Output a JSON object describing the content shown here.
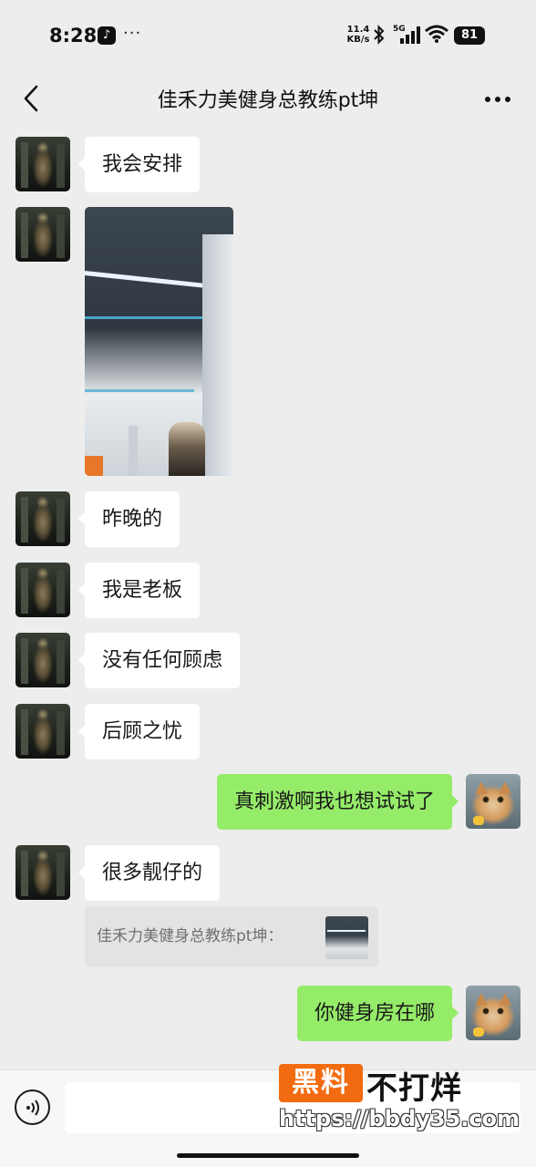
{
  "status_bar": {
    "time": "8:28",
    "app_icon": "tiktok-icon",
    "more": "···",
    "net_speed_value": "11.4",
    "net_speed_unit": "KB/s",
    "network": "5G",
    "battery": "81"
  },
  "header": {
    "title": "佳禾力美健身总教练pt坤",
    "back_icon": "chevron-left-icon",
    "menu_icon": "more-horizontal-icon"
  },
  "messages": [
    {
      "type": "text",
      "side": "in",
      "text": "我会安排"
    },
    {
      "type": "image",
      "side": "in",
      "description_icon": "gym-photo"
    },
    {
      "type": "text",
      "side": "in",
      "text": "昨晚的"
    },
    {
      "type": "text",
      "side": "in",
      "text": "我是老板"
    },
    {
      "type": "text",
      "side": "in",
      "text": "没有任何顾虑"
    },
    {
      "type": "text",
      "side": "in",
      "text": "后顾之忧"
    },
    {
      "type": "text",
      "side": "out",
      "text": "真刺激啊我也想试试了"
    },
    {
      "type": "text",
      "side": "in",
      "text": "很多靓仔的"
    },
    {
      "type": "text",
      "side": "out",
      "text": "你健身房在哪"
    }
  ],
  "quote": {
    "text": "佳禾力美健身总教练pt坤："
  },
  "input_bar": {
    "voice_icon": "voice-icon",
    "placeholder": ""
  },
  "watermark": {
    "box_text": "黑料",
    "brand": "不打烊",
    "url": "https://bbdy35.com"
  },
  "colors": {
    "background": "#ededed",
    "incoming_bubble": "#ffffff",
    "outgoing_bubble": "#95ec69",
    "watermark_orange": "#f26b10"
  }
}
